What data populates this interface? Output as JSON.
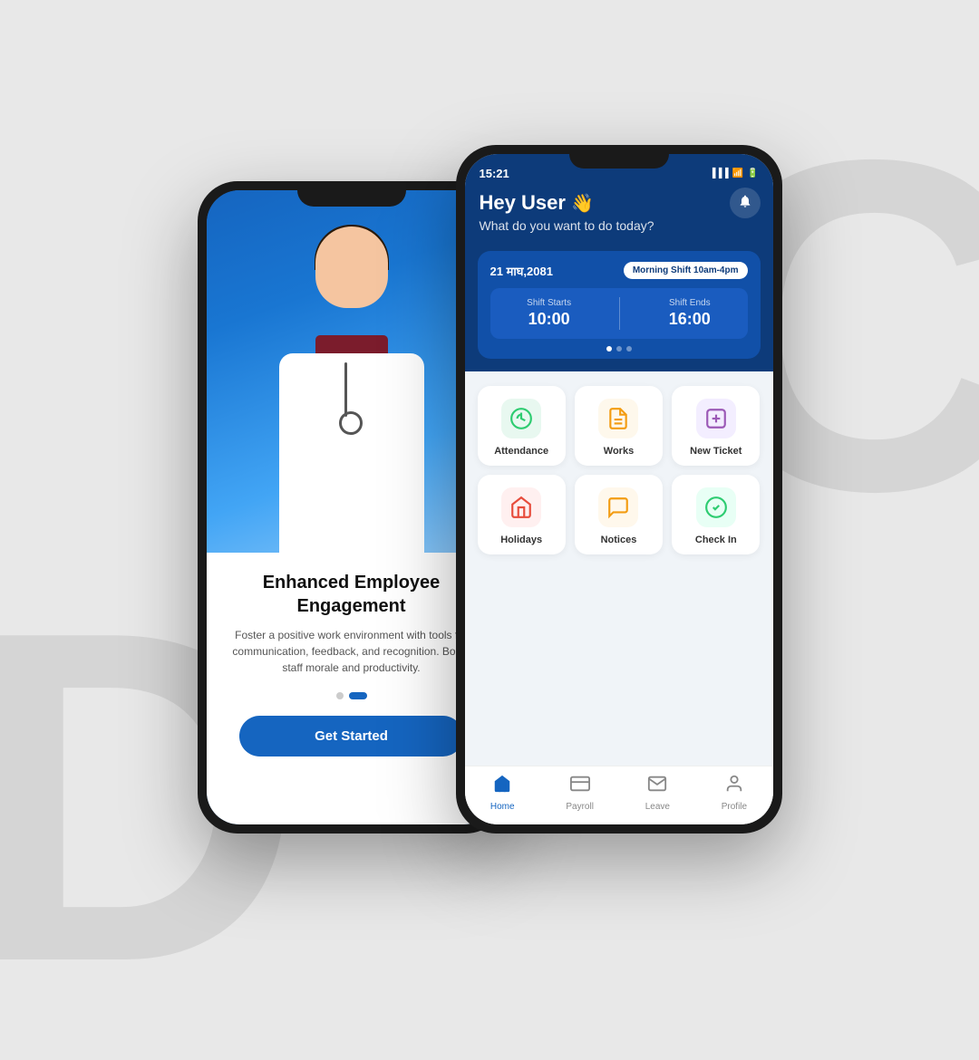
{
  "background": {
    "letter_d": "D",
    "letter_c": "C"
  },
  "phone_left": {
    "card_title": "Enhanced Employee Engagement",
    "card_desc": "Foster a positive work environment with tools for communication, feedback, and recognition. Boost staff morale and productivity.",
    "get_started_label": "Get Started",
    "dots": [
      false,
      true
    ],
    "hero_alt": "Doctor in white coat with stethoscope"
  },
  "phone_right": {
    "status_bar": {
      "time": "15:21",
      "signal": "▐▐▐",
      "wifi": "WiFi",
      "battery": "🔋"
    },
    "header": {
      "greeting": "Hey User",
      "greeting_emoji": "👋",
      "subtitle": "What do you want to do today?",
      "bell_label": "Notifications"
    },
    "shift_card": {
      "date": "21 माघ,2081",
      "shift_badge": "Morning Shift 10am-4pm",
      "shift_starts_label": "Shift Starts",
      "shift_starts_value": "10:00",
      "shift_ends_label": "Shift Ends",
      "shift_ends_value": "16:00"
    },
    "grid_items": [
      {
        "id": "attendance",
        "label": "Attendance",
        "icon": "📊",
        "color": "#e8f8f0"
      },
      {
        "id": "works",
        "label": "Works",
        "icon": "📄",
        "color": "#fef8ec"
      },
      {
        "id": "new-ticket",
        "label": "New Ticket",
        "icon": "➕",
        "color": "#f3eeff"
      },
      {
        "id": "holidays",
        "label": "Holidays",
        "icon": "🏠",
        "color": "#fff0f0"
      },
      {
        "id": "notices",
        "label": "Notices",
        "icon": "💬",
        "color": "#fff8ec"
      },
      {
        "id": "check-in",
        "label": "Check In",
        "icon": "✅",
        "color": "#e8fff5"
      }
    ],
    "bottom_nav": [
      {
        "id": "home",
        "label": "Home",
        "icon": "🏠",
        "active": true
      },
      {
        "id": "payroll",
        "label": "Payroll",
        "icon": "💳",
        "active": false
      },
      {
        "id": "leave",
        "label": "Leave",
        "icon": "✉️",
        "active": false
      },
      {
        "id": "profile",
        "label": "Profile",
        "icon": "👤",
        "active": false
      }
    ]
  }
}
